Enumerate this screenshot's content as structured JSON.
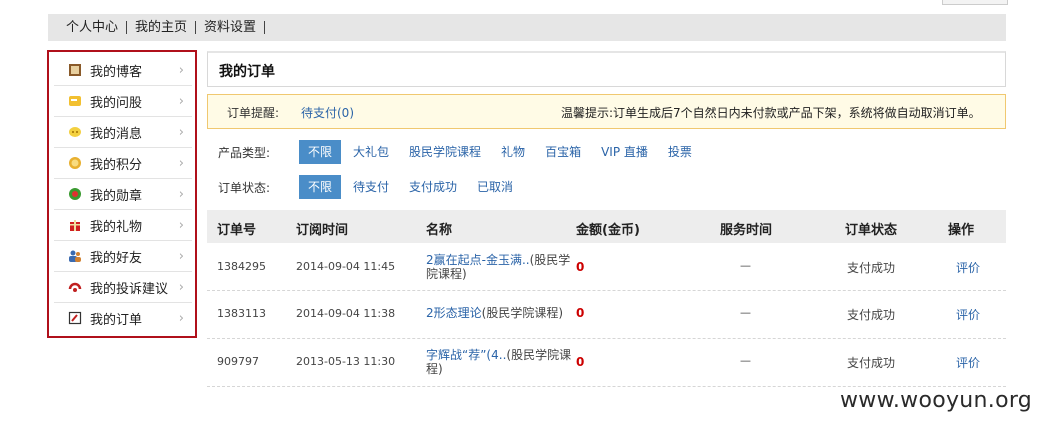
{
  "top_nav": {
    "items": [
      "个人中心",
      "我的主页",
      "资料设置"
    ]
  },
  "sidebar": {
    "items": [
      {
        "label": "我的博客",
        "icon": "blog-icon",
        "color": "#8a5a2a"
      },
      {
        "label": "我的问股",
        "icon": "question-stock-icon",
        "color": "#e8b020"
      },
      {
        "label": "我的消息",
        "icon": "message-icon",
        "color": "#f0c020"
      },
      {
        "label": "我的积分",
        "icon": "points-icon",
        "color": "#e0a020"
      },
      {
        "label": "我的勋章",
        "icon": "medal-icon",
        "color": "#3a9a30"
      },
      {
        "label": "我的礼物",
        "icon": "gift-icon",
        "color": "#d02020"
      },
      {
        "label": "我的好友",
        "icon": "friends-icon",
        "color": "#3a6ab0"
      },
      {
        "label": "我的投诉建议",
        "icon": "complaint-icon",
        "color": "#c02020"
      },
      {
        "label": "我的订单",
        "icon": "order-icon",
        "color": "#b02020"
      }
    ],
    "arrow": "›"
  },
  "main": {
    "title": "我的订单",
    "reminder": {
      "label": "订单提醒:",
      "pending_link": "待支付(0)",
      "tip": "温馨提示:订单生成后7个自然日内未付款或产品下架，系统将做自动取消订单。"
    },
    "filters": {
      "product_type": {
        "label": "产品类型:",
        "options": [
          "不限",
          "大礼包",
          "股民学院课程",
          "礼物",
          "百宝箱",
          "VIP 直播",
          "投票"
        ],
        "selected": "不限"
      },
      "order_status": {
        "label": "订单状态:",
        "options": [
          "不限",
          "待支付",
          "支付成功",
          "已取消"
        ],
        "selected": "不限"
      }
    },
    "table": {
      "headers": [
        "订单号",
        "订阅时间",
        "名称",
        "金额(金币)",
        "服务时间",
        "订单状态",
        "操作"
      ],
      "rows": [
        {
          "order_id": "1384295",
          "time": "2014-09-04 11:45",
          "name_link": "2赢在起点-金玉满..",
          "name_suffix": "(股民学院课程)",
          "amount": "0",
          "service": "—",
          "status": "支付成功",
          "action": "评价"
        },
        {
          "order_id": "1383113",
          "time": "2014-09-04 11:38",
          "name_link": "2形态理论",
          "name_suffix": "(股民学院课程)",
          "amount": "0",
          "service": "—",
          "status": "支付成功",
          "action": "评价"
        },
        {
          "order_id": "909797",
          "time": "2013-05-13 11:30",
          "name_link": "字辉战“荐”(4..",
          "name_suffix": "(股民学院课程)",
          "amount": "0",
          "service": "—",
          "status": "支付成功",
          "action": "评价"
        }
      ]
    }
  },
  "watermark": "www.wooyun.org",
  "colors": {
    "accent_blue": "#4a8dc8",
    "link": "#2b64a8",
    "highlight_border": "#b0101b",
    "amount_red": "#cc0000"
  }
}
